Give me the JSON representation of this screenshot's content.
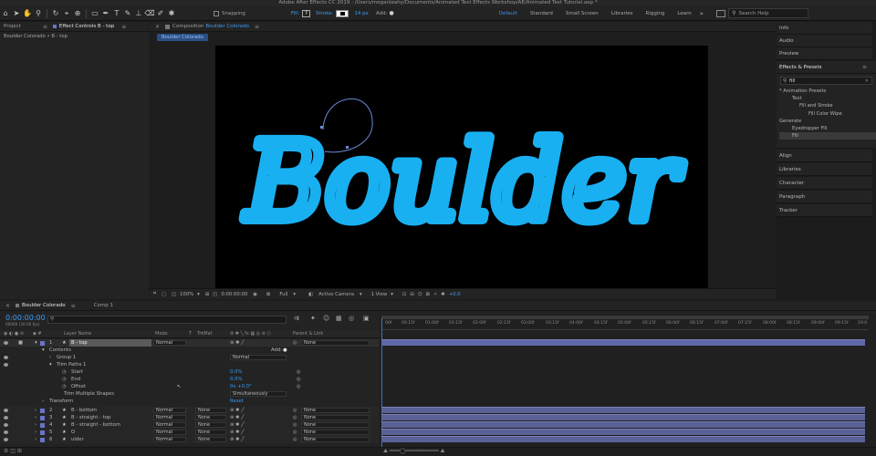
{
  "window": {
    "title": "Adobe After Effects CC 2019 - /Users/meganleahy/Documents/Animated Text Effects Workshop/AE/Animated Text Tutorial.aep *"
  },
  "toolbar": {
    "snapping": "Snapping",
    "fill": "Fill:",
    "stroke": "Stroke:",
    "stroke_px": "14 px",
    "add": "Add:",
    "workspaces": [
      "Default",
      "Standard",
      "Small Screen",
      "Libraries",
      "Rigging",
      "Learn"
    ],
    "active_workspace": "Default",
    "search_placeholder": "Search Help"
  },
  "project_panel": {
    "tab_project": "Project",
    "tab_effect_controls": "Effect Controls B - top",
    "subtitle": "Boulder Colorado • B - top"
  },
  "composition": {
    "tab": "Composition",
    "tab_name": "Boulder Colorado",
    "breadcrumb": "Boulder Colorado",
    "text": "Boulder",
    "text_color": "#19b0f2",
    "footer": {
      "zoom": "100%",
      "timecode": "0:00:00:00",
      "resolution": "Full",
      "camera": "Active Camera",
      "view": "1 View",
      "exposure": "+0.0"
    }
  },
  "right_panel": {
    "info": "Info",
    "audio": "Audio",
    "preview": "Preview",
    "effects_presets": "Effects & Presets",
    "search_value": "fill",
    "tree": [
      {
        "label": "* Animation Presets",
        "indent": 0
      },
      {
        "label": "Text",
        "indent": 1
      },
      {
        "label": "Fill and Stroke",
        "indent": 2
      },
      {
        "label": "Fill Color Wipe",
        "indent": 3
      },
      {
        "label": "Generate",
        "indent": 0
      },
      {
        "label": "Eyedropper Fill",
        "indent": 1
      },
      {
        "label": "Fill",
        "indent": 1
      }
    ],
    "collapsed": [
      "Align",
      "Libraries",
      "Character",
      "Paragraph",
      "Tracker"
    ]
  },
  "timeline": {
    "tab_active": "Boulder Colorado",
    "tab_other": "Comp 1",
    "timecode": "0:00:00:00",
    "fps": "00000 (30.00 fps)",
    "headers": {
      "layer_name": "Layer Name",
      "mode": "Mode",
      "t": "T",
      "trkmat": "TrkMat",
      "parent": "Parent & Link"
    },
    "ruler": [
      "00f",
      "00:15f",
      "01:00f",
      "01:15f",
      "02:00f",
      "02:15f",
      "03:00f",
      "03:15f",
      "04:00f",
      "04:15f",
      "05:00f",
      "05:15f",
      "06:00f",
      "06:15f",
      "07:00f",
      "07:15f",
      "08:00f",
      "08:15f",
      "09:00f",
      "09:15f",
      "10:0"
    ],
    "layer1": {
      "num": "1",
      "name": "B - top",
      "mode": "Normal",
      "parent": "None",
      "color": "#6a73c8"
    },
    "contents": "Contents",
    "add_label": "Add:",
    "group1": {
      "label": "Group 1",
      "mode": "Normal"
    },
    "trim_paths": "Trim Paths 1",
    "props": [
      {
        "label": "Start",
        "value": "0.0%"
      },
      {
        "label": "End",
        "value": "0.0%"
      },
      {
        "label": "Offset",
        "value": "0x +0.0°"
      }
    ],
    "trim_multiple": {
      "label": "Trim Multiple Shapes",
      "value": "Simultaneously"
    },
    "transform": {
      "label": "Transform",
      "reset": "Reset"
    },
    "layers": [
      {
        "num": "2",
        "name": "B - bottom",
        "mode": "Normal",
        "trkmat": "None",
        "parent": "None"
      },
      {
        "num": "3",
        "name": "B - straight - top",
        "mode": "Normal",
        "trkmat": "None",
        "parent": "None"
      },
      {
        "num": "4",
        "name": "B - straight - bottom",
        "mode": "Normal",
        "trkmat": "None",
        "parent": "None"
      },
      {
        "num": "5",
        "name": "O",
        "mode": "Normal",
        "trkmat": "None",
        "parent": "None"
      },
      {
        "num": "6",
        "name": "ulder",
        "mode": "Normal",
        "trkmat": "None",
        "parent": "None"
      }
    ]
  }
}
